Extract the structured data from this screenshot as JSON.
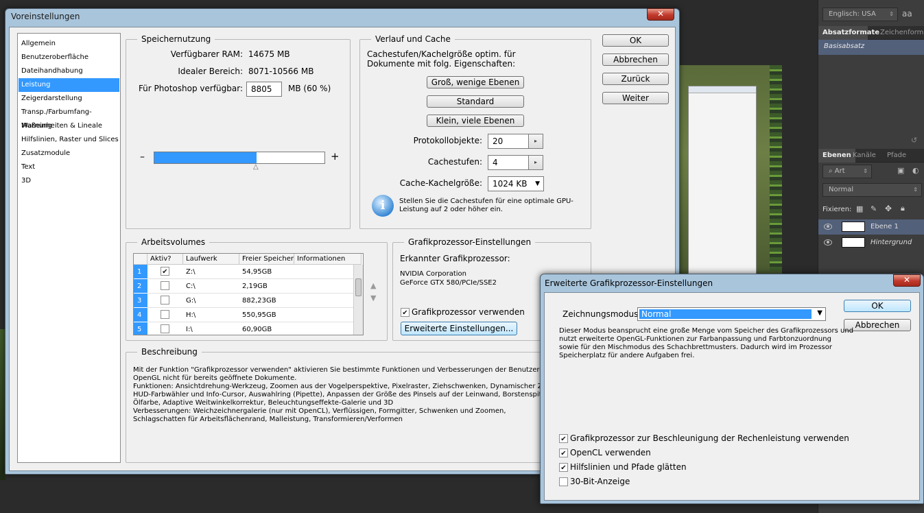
{
  "right_panel": {
    "language": "Englisch: USA",
    "aa_icon": "aa",
    "tabs_top": [
      "Absatzformate",
      "Zeichenforma"
    ],
    "paragraph_style": "Basisabsatz",
    "tabs_layers": [
      "Ebenen",
      "Kanäle",
      "Pfade"
    ],
    "filter": "Art",
    "blend_mode": "Normal",
    "lock_label": "Fixieren:",
    "layers": [
      {
        "name": "Ebene 1"
      },
      {
        "name": "Hintergrund"
      }
    ]
  },
  "main": {
    "title": "Voreinstellungen",
    "close": "✕",
    "nav": [
      "Allgemein",
      "Benutzeroberfläche",
      "Dateihandhabung",
      "Leistung",
      "Zeigerdarstellung",
      "Transp./Farbumfang-Warnung",
      "Maßeinheiten & Lineale",
      "Hilfslinien, Raster und Slices",
      "Zusatzmodule",
      "Text",
      "3D"
    ],
    "selected_nav": "Leistung",
    "buttons": {
      "ok": "OK",
      "cancel": "Abbrechen",
      "back": "Zurück",
      "next": "Weiter"
    },
    "memory": {
      "title": "Speichernutzung",
      "available_label": "Verfügbarer RAM:",
      "available_value": "14675 MB",
      "ideal_label": "Idealer Bereich:",
      "ideal_value": "8071-10566 MB",
      "ps_label": "Für Photoshop verfügbar:",
      "ps_value": "8805",
      "ps_unit": "MB (60 %)",
      "minus": "–",
      "plus": "+",
      "slider_fraction": 0.6
    },
    "cache": {
      "title": "Verlauf und Cache",
      "desc": "Cachestufen/Kachelgröße optim. für Dokumente mit folg. Eigenschaften:",
      "btn_large": "Groß, wenige Ebenen",
      "btn_default": "Standard",
      "btn_small": "Klein, viele Ebenen",
      "history_label": "Protokollobjekte:",
      "history_value": "20",
      "levels_label": "Cachestufen:",
      "levels_value": "4",
      "tile_label": "Cache-Kachelgröße:",
      "tile_value": "1024 KB",
      "info": "Stellen Sie die Cachestufen für eine optimale GPU-Leistung auf 2 oder höher ein."
    },
    "volumes": {
      "title": "Arbeitsvolumes",
      "headers": [
        "Aktiv?",
        "Laufwerk",
        "Freier Speicher",
        "Informationen"
      ],
      "rows": [
        {
          "n": "1",
          "active": true,
          "drive": "Z:\\",
          "free": "54,95GB"
        },
        {
          "n": "2",
          "active": false,
          "drive": "C:\\",
          "free": "2,19GB"
        },
        {
          "n": "3",
          "active": false,
          "drive": "G:\\",
          "free": "882,23GB"
        },
        {
          "n": "4",
          "active": false,
          "drive": "H:\\",
          "free": "550,95GB"
        },
        {
          "n": "5",
          "active": false,
          "drive": "I:\\",
          "free": "60,90GB"
        }
      ]
    },
    "gpu": {
      "title": "Grafikprozessor-Einstellungen",
      "detected_label": "Erkannter Grafikprozessor:",
      "vendor": "NVIDIA Corporation",
      "model": "GeForce GTX 580/PCIe/SSE2",
      "use_gpu": "Grafikprozessor verwenden",
      "advanced_btn": "Erweiterte Einstellungen..."
    },
    "description": {
      "title": "Beschreibung",
      "lines": [
        "Mit der Funktion \"Grafikprozessor verwenden\" aktivieren Sie bestimmte Funktionen und Verbesserungen der Benutzeroberfläche. Si",
        "OpenGL nicht für bereits geöffnete Dokumente.",
        "Funktionen: Ansichtdrehung-Werkzeug, Zoomen aus der Vogelperspektive, Pixelraster, Ziehschwenken, Dynamischer Zoom,",
        "HUD-Farbwähler und Info-Cursor, Auswahlring (Pipette), Anpassen der Größe des Pinsels auf der Leinwand, Borstenspitzenvorscha",
        "Ölfarbe, Adaptive Weitwinkelkorrektur, Beleuchtungseffekte-Galerie und 3D",
        "Verbesserungen: Weichzeichnergalerie (nur mit OpenCL), Verflüssigen, Formgitter, Schwenken und Zoomen,",
        "Schlagschatten für Arbeitsflächenrand, Malleistung, Transformieren/Verformen"
      ]
    }
  },
  "gpu_dialog": {
    "title": "Erweiterte Grafikprozessor-Einstellungen",
    "close": "✕",
    "mode_label": "Zeichnungsmodus:",
    "mode_value": "Normal",
    "ok": "OK",
    "cancel": "Abbrechen",
    "desc": [
      "Dieser Modus beansprucht eine große Menge vom Speicher des Grafikprozessors und",
      "nutzt erweiterte OpenGL-Funktionen zur Farbanpassung und Farbtonzuordnung",
      "sowie für den Mischmodus des Schachbrettmusters. Dadurch wird im Prozessor",
      "Speicherplatz für andere Aufgaben frei."
    ],
    "checks": [
      {
        "label": "Grafikprozessor zur Beschleunigung der Rechenleistung verwenden",
        "on": true
      },
      {
        "label": "OpenCL verwenden",
        "on": true
      },
      {
        "label": "Hilfslinien und Pfade glätten",
        "on": true
      },
      {
        "label": "30-Bit-Anzeige",
        "on": false
      }
    ]
  }
}
